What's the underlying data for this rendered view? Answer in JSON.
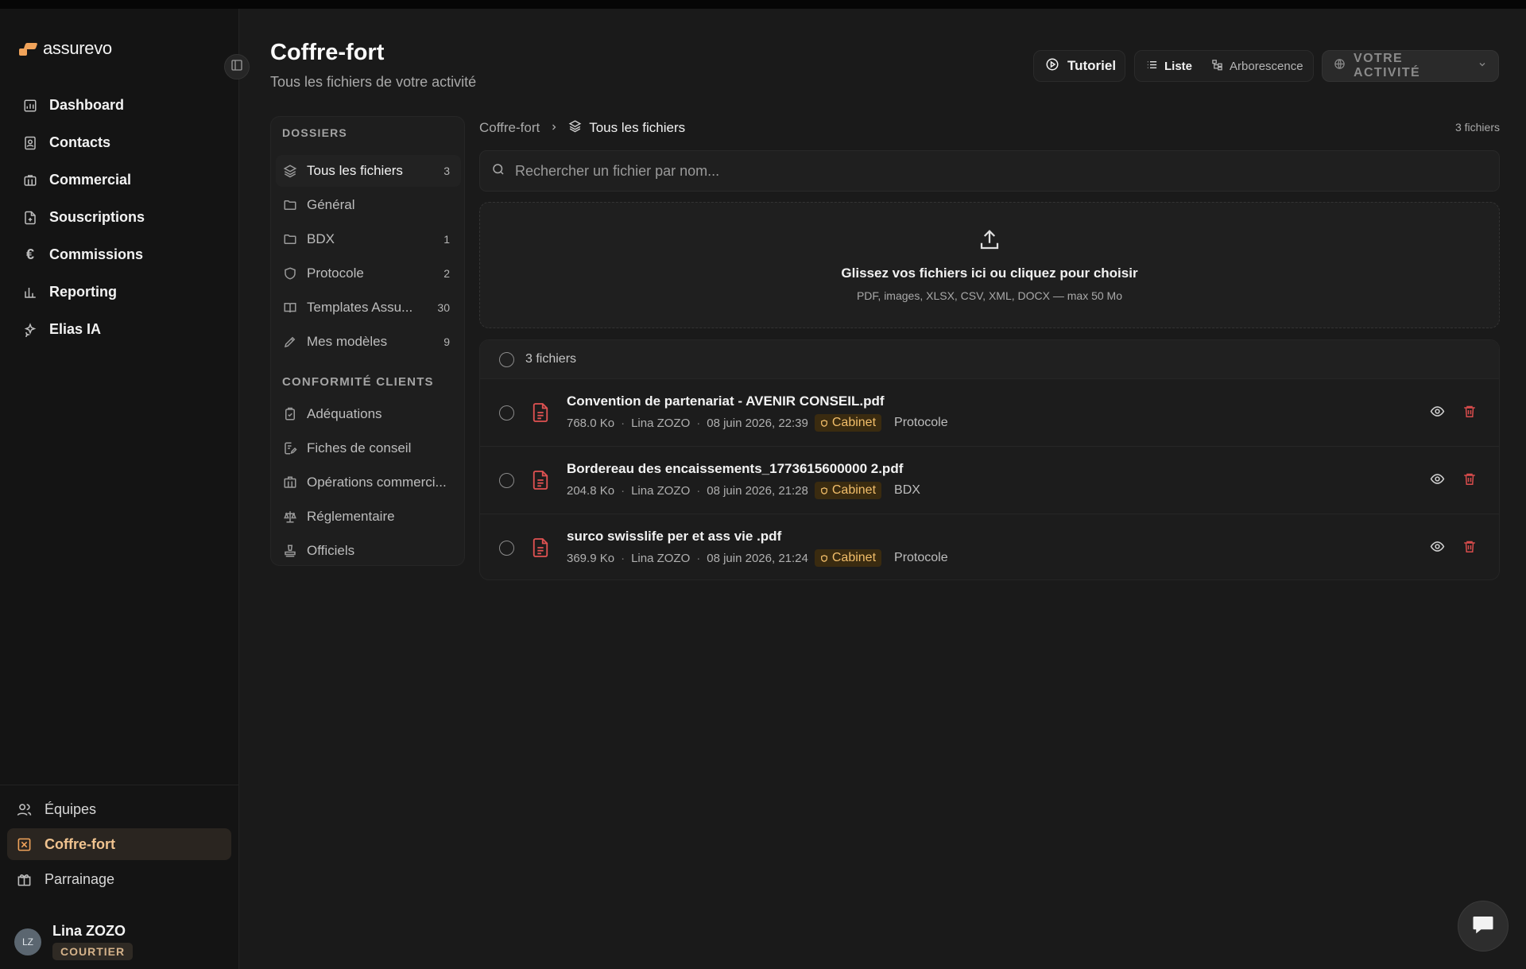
{
  "app": {
    "logo_text": "assurevo",
    "accent": "#f0a35a"
  },
  "sidebar": {
    "items": [
      {
        "label": "Dashboard",
        "icon": "dashboard-icon"
      },
      {
        "label": "Contacts",
        "icon": "contacts-icon"
      },
      {
        "label": "Commercial",
        "icon": "briefcase-icon"
      },
      {
        "label": "Souscriptions",
        "icon": "document-plus-icon"
      },
      {
        "label": "Commissions",
        "icon": "euro-icon"
      },
      {
        "label": "Reporting",
        "icon": "bar-chart-icon"
      },
      {
        "label": "Elias IA",
        "icon": "sparkles-icon"
      }
    ],
    "bottom_items": [
      {
        "label": "Équipes",
        "icon": "users-icon"
      },
      {
        "label": "Coffre-fort",
        "icon": "vault-icon",
        "active": true
      },
      {
        "label": "Parrainage",
        "icon": "gift-icon"
      }
    ],
    "user": {
      "initials": "LZ",
      "name": "Lina ZOZO",
      "role": "COURTIER"
    }
  },
  "header": {
    "title": "Coffre-fort",
    "subtitle": "Tous les fichiers de votre activité",
    "tutorial_label": "Tutoriel",
    "view_list_label": "Liste",
    "view_tree_label": "Arborescence",
    "activity_label": "VOTRE ACTIVITÉ"
  },
  "folders": {
    "section1": "DOSSIERS",
    "items": [
      {
        "label": "Tous les fichiers",
        "count": "3",
        "icon": "layers-icon",
        "active": true
      },
      {
        "label": "Général",
        "count": "",
        "icon": "folder-icon"
      },
      {
        "label": "BDX",
        "count": "1",
        "icon": "folder-icon"
      },
      {
        "label": "Protocole",
        "count": "2",
        "icon": "shield-icon"
      },
      {
        "label": "Templates Assu...",
        "count": "30",
        "icon": "book-icon"
      },
      {
        "label": "Mes modèles",
        "count": "9",
        "icon": "pen-icon"
      }
    ],
    "section2": "CONFORMITÉ CLIENTS",
    "compliance": [
      {
        "label": "Adéquations",
        "icon": "clipboard-check-icon"
      },
      {
        "label": "Fiches de conseil",
        "icon": "file-edit-icon"
      },
      {
        "label": "Opérations commerci...",
        "icon": "building-icon"
      },
      {
        "label": "Réglementaire",
        "icon": "scale-icon"
      },
      {
        "label": "Officiels",
        "icon": "stamp-icon"
      }
    ]
  },
  "breadcrumb": {
    "root": "Coffre-fort",
    "current": "Tous les fichiers"
  },
  "file_count_label": "3 fichiers",
  "search": {
    "placeholder": "Rechercher un fichier par nom..."
  },
  "dropzone": {
    "title": "Glissez vos fichiers ici ou cliquez pour choisir",
    "subtitle": "PDF, images, XLSX, CSV, XML, DOCX — max 50 Mo"
  },
  "list": {
    "header": "3 fichiers",
    "files": [
      {
        "name": "Convention de partenariat - AVENIR CONSEIL.pdf",
        "size": "768.0 Ko",
        "owner": "Lina ZOZO",
        "date": "08 juin 2026, 22:39",
        "tag": "Cabinet",
        "folder": "Protocole"
      },
      {
        "name": "Bordereau des encaissements_1773615600000 2.pdf",
        "size": "204.8 Ko",
        "owner": "Lina ZOZO",
        "date": "08 juin 2026, 21:28",
        "tag": "Cabinet",
        "folder": "BDX"
      },
      {
        "name": "surco swisslife per et ass vie .pdf",
        "size": "369.9 Ko",
        "owner": "Lina ZOZO",
        "date": "08 juin 2026, 21:24",
        "tag": "Cabinet",
        "folder": "Protocole"
      }
    ]
  }
}
